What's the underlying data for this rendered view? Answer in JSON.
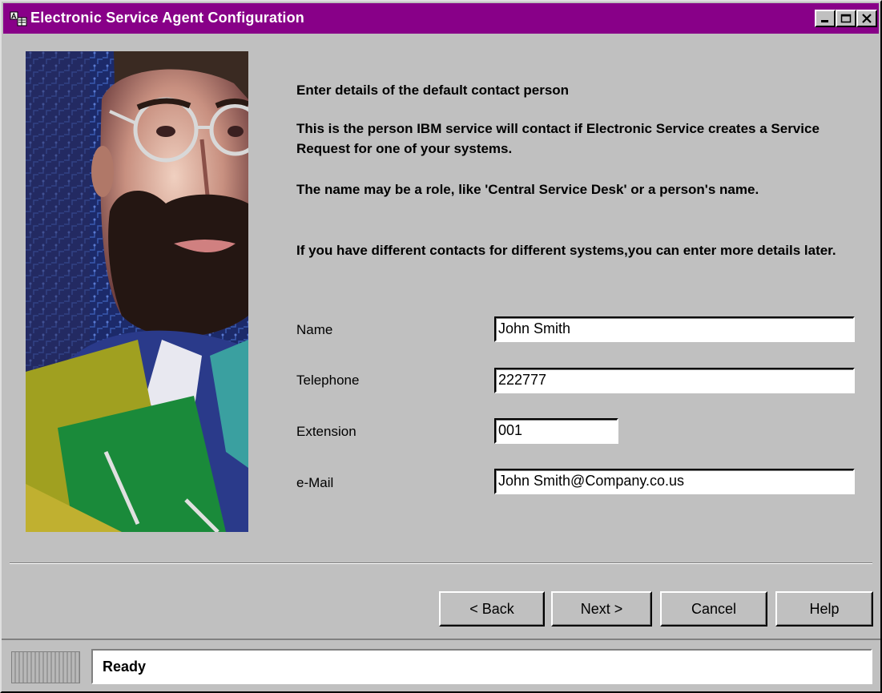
{
  "window": {
    "title": "Electronic Service Agent Configuration"
  },
  "content": {
    "heading": "Enter details of the default contact person",
    "para1": "This is the person IBM service will contact if Electronic Service creates a Service Request for one of your systems.",
    "para2": "The name may be a role, like 'Central Service Desk' or a person's name.",
    "para3": "If you have different contacts for different systems,you can enter more details later."
  },
  "form": {
    "name_label": "Name",
    "name_value": "John Smith",
    "telephone_label": "Telephone",
    "telephone_value": "222777",
    "extension_label": "Extension",
    "extension_value": "001",
    "email_label": "e-Mail",
    "email_value": "John Smith@Company.co.us"
  },
  "buttons": {
    "back": "< Back",
    "next": "Next >",
    "cancel": "Cancel",
    "help": "Help"
  },
  "status": {
    "text": "Ready"
  },
  "colors": {
    "titlebar": "#880088",
    "face": "#c0c0c0"
  }
}
